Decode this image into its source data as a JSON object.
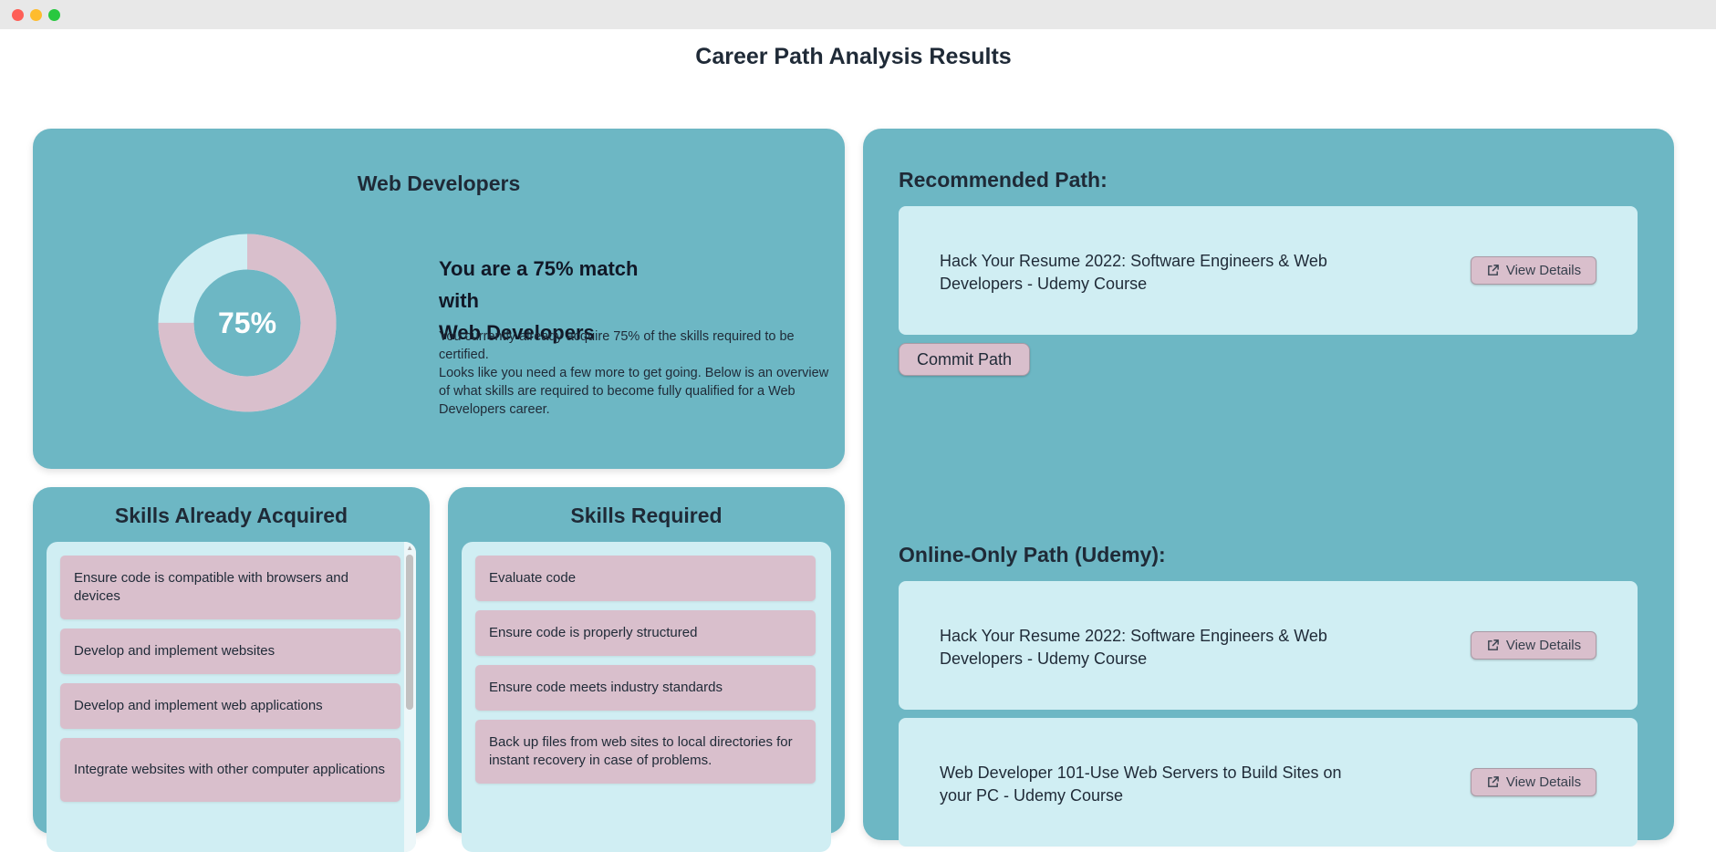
{
  "window": {
    "title": ""
  },
  "page": {
    "title": "Career Path Analysis Results"
  },
  "match": {
    "career": "Web Developers",
    "percent_label": "75%",
    "percent_value": 0.75,
    "headline_line1": "You are a 75% match with",
    "headline_line2": "Web Developers",
    "description_line1": "You currently already acquire 75% of the skills required to be certified.",
    "description_line2": "Looks like you need a few more to get going. Below is an overview of what skills are required to become fully qualified for a Web Developers career.",
    "colors": {
      "acquired": "#d9bfcc",
      "remaining": "#d0eef3",
      "center": "#6db7c4"
    }
  },
  "skills_acquired": {
    "title": "Skills Already Acquired",
    "items": [
      "Ensure code is compatible with browsers and devices",
      "Develop and implement websites",
      "Develop and implement web applications",
      "Integrate websites with other computer applications"
    ]
  },
  "skills_required": {
    "title": "Skills Required",
    "items": [
      "Evaluate code",
      "Ensure code is properly structured",
      "Ensure code meets industry standards",
      "Back up files from web sites to local directories for instant recovery in case of problems."
    ]
  },
  "recommended": {
    "title": "Recommended Path:",
    "course": "Hack Your Resume 2022: Software Engineers & Web Developers - Udemy Course",
    "view_label": "View Details",
    "commit_label": "Commit Path"
  },
  "online": {
    "title": "Online-Only Path (Udemy):",
    "courses": [
      {
        "name": "Hack Your Resume 2022: Software Engineers & Web Developers - Udemy Course",
        "view_label": "View Details"
      },
      {
        "name": "Web Developer 101-Use Web Servers to Build Sites on your PC - Udemy Course",
        "view_label": "View Details"
      }
    ]
  },
  "icons": {
    "view_details": "external-link-icon"
  }
}
